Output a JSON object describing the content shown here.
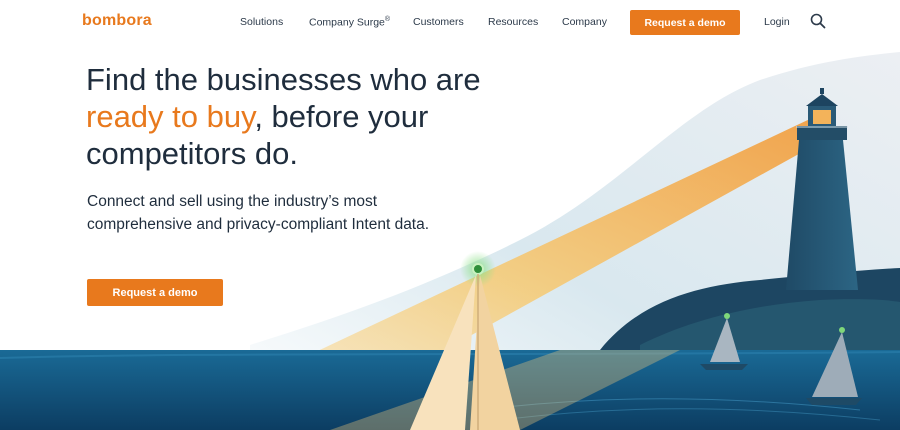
{
  "brand": {
    "logo_text": "bombora",
    "accent": "#e8791d",
    "dark": "#1f2d3d"
  },
  "nav": {
    "items": [
      {
        "label": "Solutions"
      },
      {
        "label": "Company Surge",
        "sup": "®"
      },
      {
        "label": "Customers"
      },
      {
        "label": "Resources"
      },
      {
        "label": "Company"
      }
    ],
    "cta_label": "Request a demo",
    "login_label": "Login",
    "search_icon": "search-icon"
  },
  "hero": {
    "headline_part1": "Find the businesses who are ",
    "headline_highlight": "ready to buy",
    "headline_part2": ", before your competitors do.",
    "subtext": "Connect and sell using the industry’s most comprehensive and privacy-compliant Intent data.",
    "cta_label": "Request a demo",
    "illustration": "lighthouse-sailboats-illustration"
  }
}
